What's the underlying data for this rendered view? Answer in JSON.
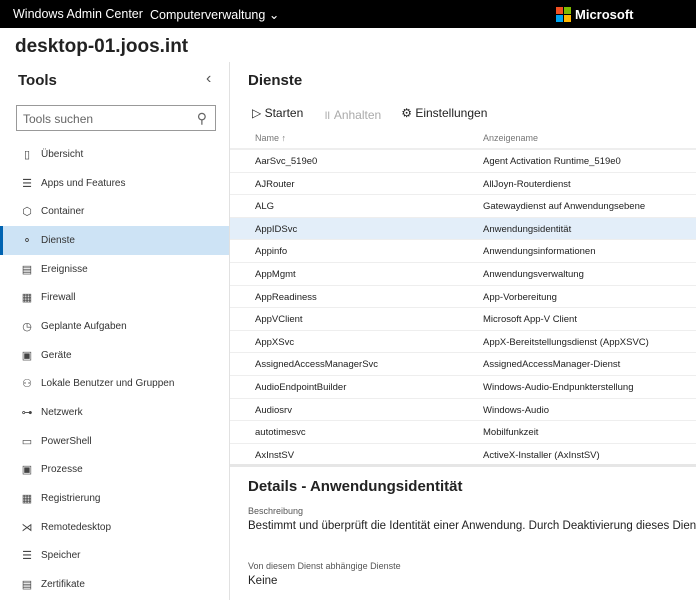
{
  "topbar": {
    "app_title": "Windows Admin Center",
    "context": "Computerverwaltung",
    "brand": "Microsoft"
  },
  "host": "desktop-01.joos.int",
  "sidebar": {
    "title": "Tools",
    "search_placeholder": "Tools suchen",
    "items": [
      {
        "label": "Übersicht",
        "icon": "device-icon"
      },
      {
        "label": "Apps und Features",
        "icon": "list-icon"
      },
      {
        "label": "Container",
        "icon": "cube-icon"
      },
      {
        "label": "Dienste",
        "icon": "services-icon",
        "selected": true
      },
      {
        "label": "Ereignisse",
        "icon": "event-icon"
      },
      {
        "label": "Firewall",
        "icon": "firewall-icon"
      },
      {
        "label": "Geplante Aufgaben",
        "icon": "calendar-icon"
      },
      {
        "label": "Geräte",
        "icon": "devices-icon"
      },
      {
        "label": "Lokale Benutzer und Gruppen",
        "icon": "users-icon"
      },
      {
        "label": "Netzwerk",
        "icon": "network-icon"
      },
      {
        "label": "PowerShell",
        "icon": "powershell-icon"
      },
      {
        "label": "Prozesse",
        "icon": "process-icon"
      },
      {
        "label": "Registrierung",
        "icon": "registry-icon"
      },
      {
        "label": "Remotedesktop",
        "icon": "remote-icon"
      },
      {
        "label": "Speicher",
        "icon": "storage-icon"
      },
      {
        "label": "Zertifikate",
        "icon": "certificate-icon"
      }
    ]
  },
  "main": {
    "title": "Dienste",
    "toolbar": {
      "start": "Starten",
      "pause": "Anhalten",
      "settings": "Einstellungen"
    },
    "columns": {
      "name": "Name ↑",
      "display": "Anzeigename"
    },
    "rows": [
      [
        "AarSvc_519e0",
        "Agent Activation Runtime_519e0"
      ],
      [
        "AJRouter",
        "AllJoyn-Routerdienst"
      ],
      [
        "ALG",
        "Gatewaydienst auf Anwendungsebene"
      ],
      [
        "AppIDSvc",
        "Anwendungsidentität"
      ],
      [
        "Appinfo",
        "Anwendungsinformationen"
      ],
      [
        "AppMgmt",
        "Anwendungsverwaltung"
      ],
      [
        "AppReadiness",
        "App-Vorbereitung"
      ],
      [
        "AppVClient",
        "Microsoft App-V Client"
      ],
      [
        "AppXSvc",
        "AppX-Bereitstellungsdienst (AppXSVC)"
      ],
      [
        "AssignedAccessManagerSvc",
        "AssignedAccessManager-Dienst"
      ],
      [
        "AudioEndpointBuilder",
        "Windows-Audio-Endpunkterstellung"
      ],
      [
        "Audiosrv",
        "Windows-Audio"
      ],
      [
        "autotimesvc",
        "Mobilfunkzeit"
      ],
      [
        "AxInstSV",
        "ActiveX-Installer (AxInstSV)"
      ]
    ],
    "selected_row": 3
  },
  "details": {
    "title": "Details - Anwendungsidentität",
    "desc_label": "Beschreibung",
    "desc": "Bestimmt und überprüft die Identität einer Anwendung. Durch Deaktivierung dieses Dienstes",
    "deps_label": "Von diesem Dienst abhängige Dienste",
    "deps": "Keine"
  },
  "colors": {
    "accent": "#0063b1",
    "selected_nav": "#cde3f5",
    "selected_row": "#e3eef9"
  }
}
